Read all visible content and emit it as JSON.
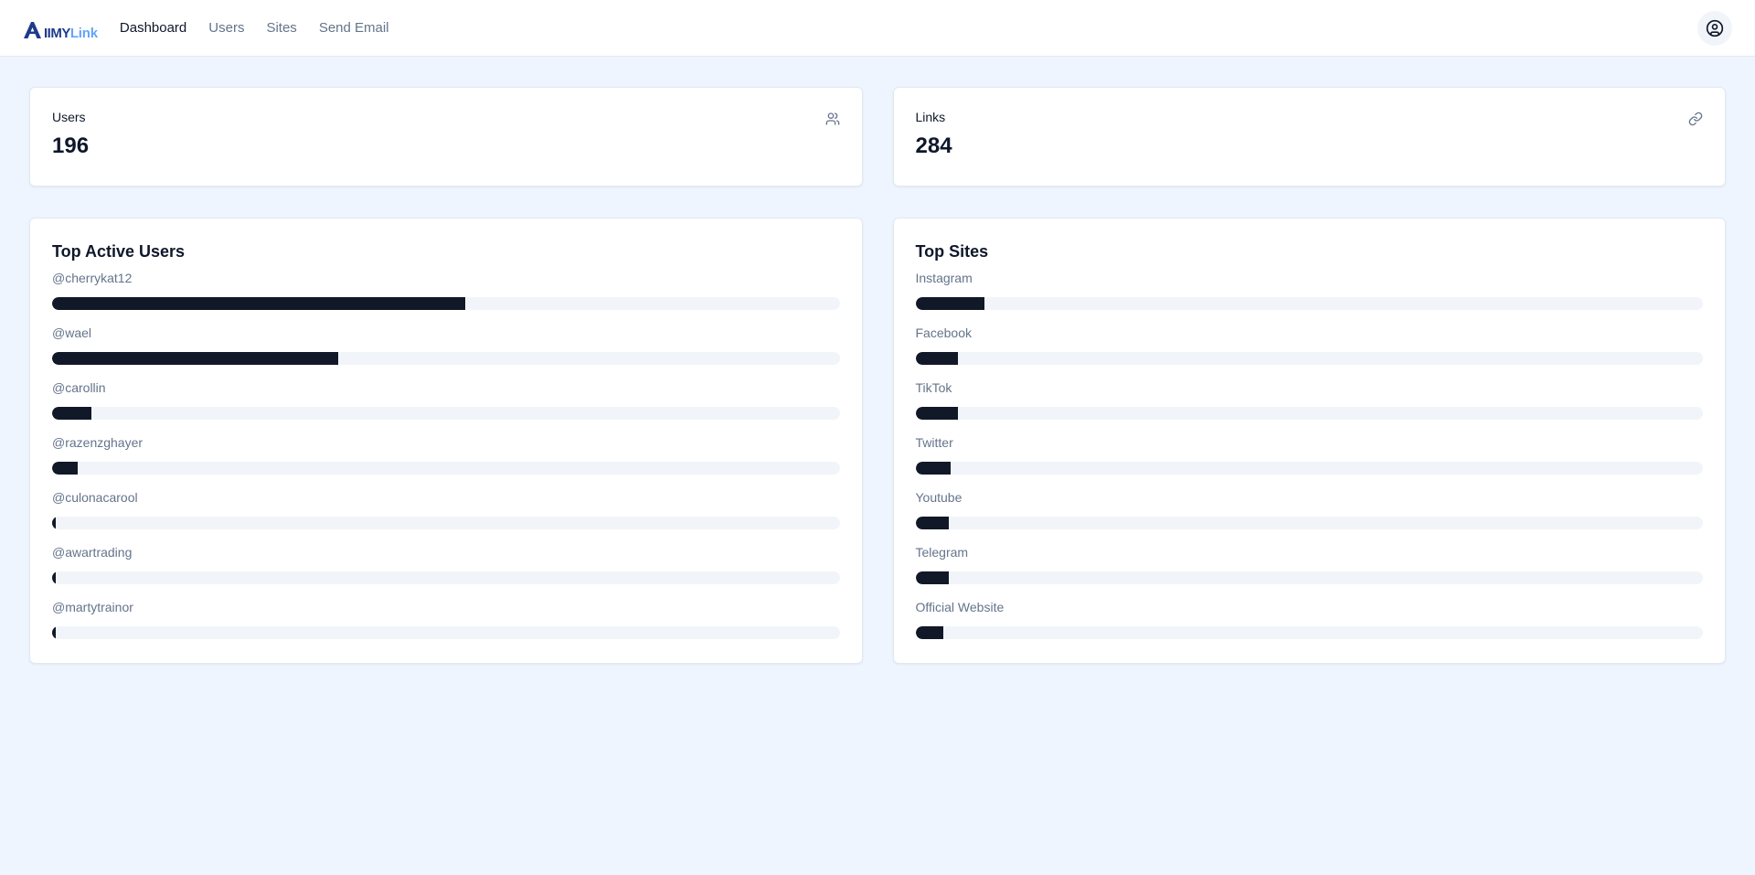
{
  "app": {
    "logo_part1": "IIMY",
    "logo_part2": "Link"
  },
  "nav": [
    {
      "label": "Dashboard",
      "active": true
    },
    {
      "label": "Users",
      "active": false
    },
    {
      "label": "Sites",
      "active": false
    },
    {
      "label": "Send Email",
      "active": false
    }
  ],
  "stats": {
    "users": {
      "label": "Users",
      "value": "196",
      "icon": "users-icon"
    },
    "links": {
      "label": "Links",
      "value": "284",
      "icon": "link-icon"
    }
  },
  "top_users": {
    "title": "Top Active Users",
    "items": [
      {
        "label": "@cherrykat12",
        "percent": 52.5
      },
      {
        "label": "@wael",
        "percent": 36.3
      },
      {
        "label": "@carollin",
        "percent": 5
      },
      {
        "label": "@razenzghayer",
        "percent": 3.2
      },
      {
        "label": "@culonacarool",
        "percent": 0.5
      },
      {
        "label": "@awartrading",
        "percent": 0.5
      },
      {
        "label": "@martytrainor",
        "percent": 0.5
      }
    ]
  },
  "top_sites": {
    "title": "Top Sites",
    "items": [
      {
        "label": "Instagram",
        "percent": 8.8
      },
      {
        "label": "Facebook",
        "percent": 5.4
      },
      {
        "label": "TikTok",
        "percent": 5.4
      },
      {
        "label": "Twitter",
        "percent": 4.5
      },
      {
        "label": "Youtube",
        "percent": 4.2
      },
      {
        "label": "Telegram",
        "percent": 4.2
      },
      {
        "label": "Official Website",
        "percent": 3.5
      }
    ]
  },
  "colors": {
    "accent": "#111827",
    "track": "#f1f5f9",
    "background": "#eff5fe"
  }
}
